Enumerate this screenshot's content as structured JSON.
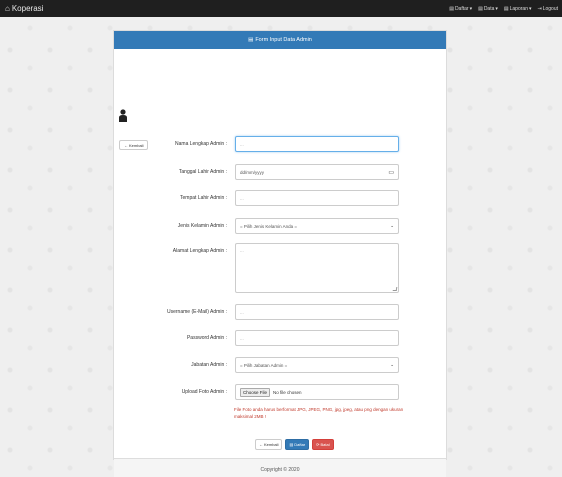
{
  "navbar": {
    "brand": "Koperasi",
    "brand_icon": "home-icon",
    "menu": [
      {
        "label": "Daftar",
        "icon": "file-icon"
      },
      {
        "label": "Data",
        "icon": "file-icon"
      },
      {
        "label": "Laporan",
        "icon": "file-icon"
      },
      {
        "label": "Logout",
        "icon": "logout-icon"
      }
    ]
  },
  "panel": {
    "title": "Form Input Data Admin",
    "back_label": "Kembali"
  },
  "form": {
    "nama_label": "Nama Lengkap Admin :",
    "nama_placeholder": "...",
    "tgl_label": "Tanggal Lahir Admin :",
    "tgl_value": "dd/mm/yyyy",
    "tempat_label": "Tempat Lahir Admin :",
    "tempat_placeholder": "...",
    "jk_label": "Jenis Kelamin Admin :",
    "jk_value": "= Pilih Jenis Kelamin Anda =",
    "alamat_label": "Alamat Lengkap Admin :",
    "alamat_placeholder": "...",
    "username_label": "Username (E-Mail) Admin :",
    "username_placeholder": "...",
    "password_label": "Password Admin :",
    "password_placeholder": "...",
    "jabatan_label": "Jabatan Admin :",
    "jabatan_value": "= Pilih Jabatan Admin =",
    "foto_label": "Upload Foto Admin :",
    "foto_button": "Choose File",
    "foto_status": "No file chosen",
    "foto_note": "File Foto anda harus berformat JPG, JPEG, PNG, jpg, jpeg, atau png dengan ukuran maksimal 2MB !"
  },
  "actions": {
    "back": "Kembali",
    "submit": "Daftar",
    "reset": "Batal"
  },
  "footer": {
    "text": "Copyright © 2020"
  },
  "colors": {
    "navbar": "#1f1f1f",
    "primary": "#337ab7",
    "danger": "#d9534f"
  }
}
